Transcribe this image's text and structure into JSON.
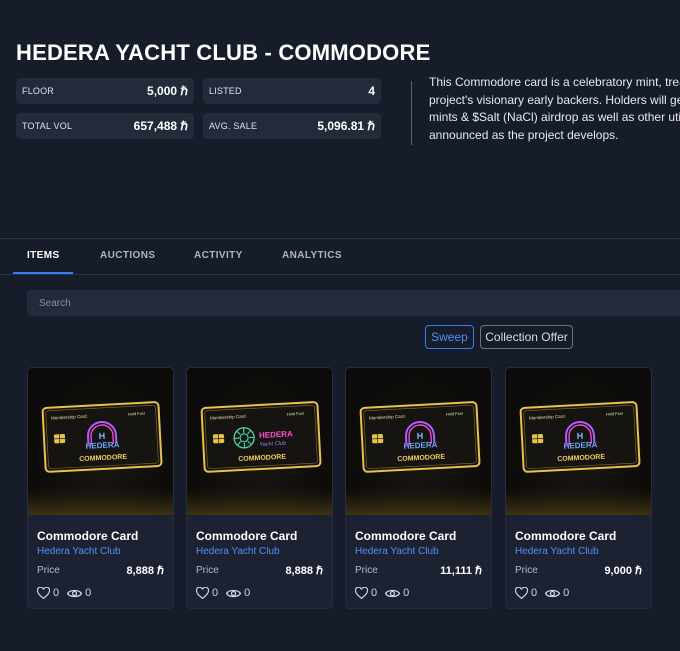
{
  "collection": {
    "title": "HEDERA YACHT CLUB - COMMODORE",
    "currency_symbol": "ℏ",
    "stats": {
      "floor_label": "FLOOR",
      "floor_value": "5,000 ℏ",
      "listed_label": "LISTED",
      "listed_value": "4",
      "total_vol_label": "TOTAL VOL",
      "total_vol_value": "657,488 ℏ",
      "avg_sale_label": "AVG. SALE",
      "avg_sale_value": "5,096.81 ℏ"
    },
    "description_lines": [
      "This Commodore card is a celebratory mint, trea",
      "project's visionary early backers. Holders will get",
      "mints & $Salt (NaCl) airdrop as well as other utili",
      "announced as the project develops."
    ]
  },
  "tabs": [
    {
      "label": "ITEMS",
      "active": true
    },
    {
      "label": "AUCTIONS",
      "active": false
    },
    {
      "label": "ACTIVITY",
      "active": false
    },
    {
      "label": "ANALYTICS",
      "active": false
    }
  ],
  "search": {
    "placeholder": "Search"
  },
  "actions": {
    "sweep_label": "Sweep",
    "offer_label": "Collection Offer"
  },
  "card_art": {
    "membership": "Membership Card",
    "hold_fast": "Hold Fast",
    "commodore": "COMMODORE",
    "logo_text": "HEDERA",
    "alt_logo_text_1": "HEDERA",
    "alt_logo_text_2": "Yacht Club"
  },
  "items": [
    {
      "name": "Commodore Card",
      "collection": "Hedera Yacht Club",
      "price_label": "Price",
      "price": "8,888 ℏ",
      "likes": "0",
      "views": "0",
      "variant": "h-logo"
    },
    {
      "name": "Commodore Card",
      "collection": "Hedera Yacht Club",
      "price_label": "Price",
      "price": "8,888 ℏ",
      "likes": "0",
      "views": "0",
      "variant": "wheel-logo"
    },
    {
      "name": "Commodore Card",
      "collection": "Hedera Yacht Club",
      "price_label": "Price",
      "price": "11,111 ℏ",
      "likes": "0",
      "views": "0",
      "variant": "h-logo"
    },
    {
      "name": "Commodore Card",
      "collection": "Hedera Yacht Club",
      "price_label": "Price",
      "price": "9,000 ℏ",
      "likes": "0",
      "views": "0",
      "variant": "h-logo"
    }
  ],
  "colors": {
    "accent": "#3a7bf5",
    "link": "#4f8ff7",
    "bg": "#161c2a",
    "panel": "#232a3a",
    "gold": "#e8c24a"
  },
  "icons": {
    "like": "heart-icon",
    "views": "eye-icon"
  }
}
